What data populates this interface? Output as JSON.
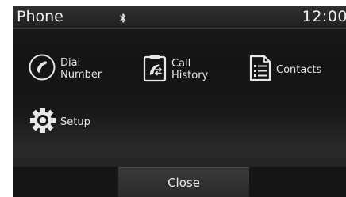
{
  "status_bar": {
    "title": "Phone",
    "bluetooth_icon": "bluetooth-icon",
    "clock": "12:00"
  },
  "menu": {
    "items": [
      {
        "id": "dial-number",
        "label": "Dial\nNumber",
        "icon": "handset-icon"
      },
      {
        "id": "call-history",
        "label": "Call\nHistory",
        "icon": "call-history-icon"
      },
      {
        "id": "contacts",
        "label": "Contacts",
        "icon": "contacts-icon"
      },
      {
        "id": "setup",
        "label": "Setup",
        "icon": "gear-icon"
      }
    ]
  },
  "footer": {
    "close_label": "Close"
  }
}
